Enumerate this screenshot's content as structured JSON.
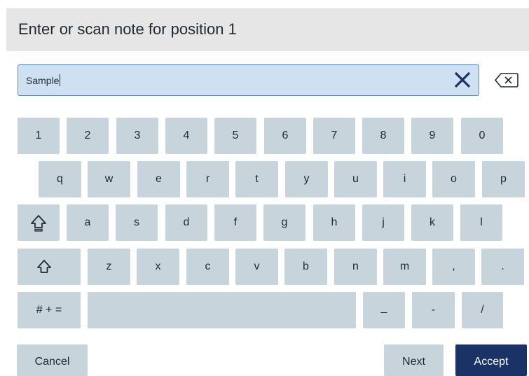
{
  "header": {
    "title": "Enter or scan note for position 1"
  },
  "input": {
    "value": "Sample"
  },
  "keyboard": {
    "row_numbers": [
      "1",
      "2",
      "3",
      "4",
      "5",
      "6",
      "7",
      "8",
      "9",
      "0"
    ],
    "row_q": [
      "q",
      "w",
      "e",
      "r",
      "t",
      "y",
      "u",
      "i",
      "o",
      "p"
    ],
    "row_a": [
      "a",
      "s",
      "d",
      "f",
      "g",
      "h",
      "j",
      "k",
      "l"
    ],
    "row_z": [
      "z",
      "x",
      "c",
      "v",
      "b",
      "n",
      "m",
      ",",
      "."
    ],
    "row_bottom": {
      "symbols": "# + =",
      "underscore": "_",
      "dash": "-",
      "slash": "/"
    }
  },
  "icons": {
    "clear": "close-x-icon",
    "backspace": "backspace-icon",
    "caps_lock": "caps-lock-icon",
    "shift": "shift-icon"
  },
  "actions": {
    "cancel": "Cancel",
    "next": "Next",
    "accept": "Accept"
  },
  "colors": {
    "accent": "#1a3266",
    "key": "#c7d4dc",
    "input_bg": "#cfe0f2",
    "input_border": "#4a8bd1"
  }
}
